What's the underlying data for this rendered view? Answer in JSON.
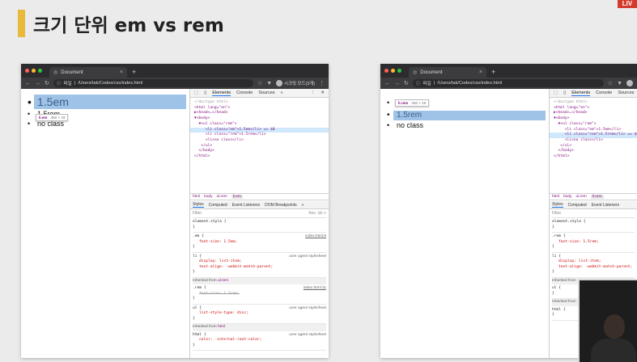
{
  "slide": {
    "title": "크기 단위 em vs rem",
    "corner_badge": "LIV"
  },
  "browser": {
    "tab_title": "Document",
    "url_prefix": "파일",
    "url": "/Users/tak/Codes/css/index.html",
    "profile_name": "시크릿 모드(3개)"
  },
  "page": {
    "items": [
      "1.5em",
      "1.5rem",
      "no class"
    ]
  },
  "devtools": {
    "tabs": [
      "Elements",
      "Console",
      "Sources"
    ],
    "more": "»",
    "dom_lines": [
      "<!doctype html>",
      "<html lang=\"en\">",
      "▶<head>…</head>",
      "▼<body>",
      "  ▼<ul class=\"rem\">",
      "     <li class=\"em\">1.5em</li> == $0",
      "     <li class=\"rem\">1.5rem</li>",
      "     <li>no class</li>",
      "   </ul>",
      "  </body>",
      "</html>"
    ],
    "dom_lines_w2": [
      "<!doctype html>",
      "<html lang=\"en\">",
      "▶<head>…</head>",
      "▼<body>",
      "  ▼<ul class=\"rem\">",
      "     <li class=\"em\">1.5em</li>",
      "     <li class=\"rem\">1.5rem</li> == $0",
      "     <li>no class</li>",
      "   </ul>",
      "  </body>",
      "</html>"
    ],
    "breadcrumbs": [
      "html",
      "body",
      "ul.rem",
      "li.em"
    ],
    "breadcrumbs_w2": [
      "html",
      "body",
      "ul.rem",
      "li.rem"
    ],
    "style_tabs": [
      "Styles",
      "Computed",
      "Event Listeners",
      "DOM Breakpoints"
    ],
    "filter_placeholder": "Filter",
    "filter_tools": ":hov .cls +",
    "rules": {
      "element_style": "element.style {",
      "em_selector": ".em {",
      "em_prop": "font-size: 1.5em;",
      "em_src": "index.html:8",
      "rem_selector_w2": ".rem {",
      "rem_prop_w2": "font-size: 1.5rem;",
      "li_selector": "li {",
      "li_prop1": "display: list-item;",
      "li_prop2": "text-align: -webkit-match-parent;",
      "li_src": "user agent stylesheet",
      "inherited_label": "Inherited from",
      "inherited_ul": "ul.rem",
      "inherited_html": "html",
      "rem_selector": ".rem {",
      "rem_prop": "font-size: 1.5rem;",
      "rem_src": "index.html:11",
      "ul_selector": "ul {",
      "ul_prop": "list-style-type: disc;",
      "ul_src": "user agent stylesheet",
      "html_selector": "html {",
      "html_prop": "color: -internal-root-color;",
      "html_src": "user agent stylesheet",
      "close": "}"
    }
  },
  "tooltips": {
    "w1_tag": "li.em",
    "w1_dim": "456 × 43",
    "w2_tag": "li.rem",
    "w2_dim": "456 × 29"
  }
}
